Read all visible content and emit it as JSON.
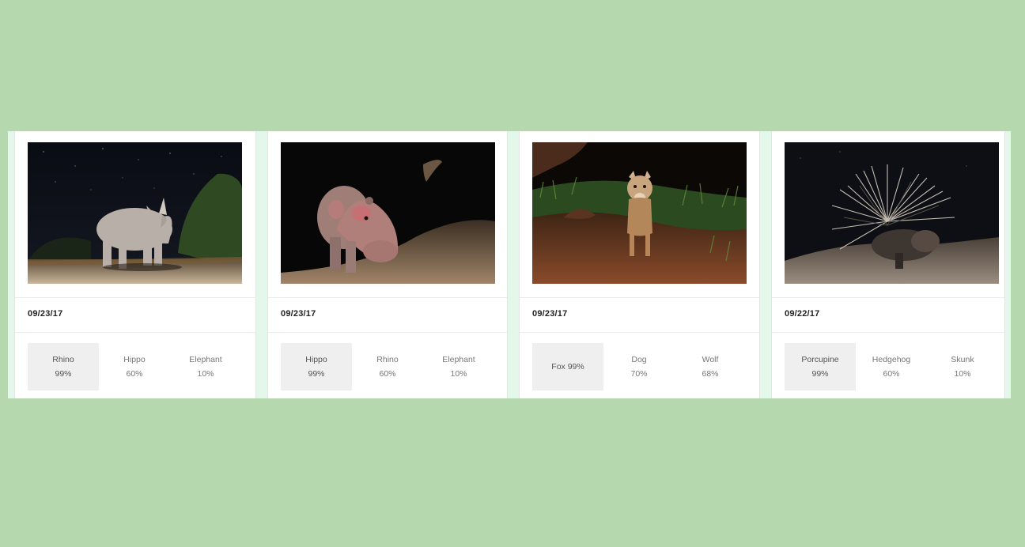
{
  "cards": [
    {
      "date": "09/23/17",
      "photo": "rhino-night-photo",
      "predictions": [
        {
          "name": "Rhino",
          "pct": "99%"
        },
        {
          "name": "Hippo",
          "pct": "60%"
        },
        {
          "name": "Elephant",
          "pct": "10%"
        }
      ]
    },
    {
      "date": "09/23/17",
      "photo": "hippo-night-photo",
      "predictions": [
        {
          "name": "Hippo",
          "pct": "99%"
        },
        {
          "name": "Rhino",
          "pct": "60%"
        },
        {
          "name": "Elephant",
          "pct": "10%"
        }
      ]
    },
    {
      "date": "09/23/17",
      "photo": "jackal-night-photo",
      "predictions": [
        {
          "name": "Fox 99%",
          "pct": ""
        },
        {
          "name": "Dog",
          "pct": "70%"
        },
        {
          "name": "Wolf",
          "pct": "68%"
        }
      ]
    },
    {
      "date": "09/22/17",
      "photo": "porcupine-night-photo",
      "predictions": [
        {
          "name": "Porcupine",
          "pct": "99%"
        },
        {
          "name": "Hedgehog",
          "pct": "60%"
        },
        {
          "name": "Skunk",
          "pct": "10%"
        }
      ]
    }
  ],
  "colors": {
    "background": "#b5d8af",
    "strip": "#e3f7ea",
    "card": "#ffffff",
    "top_prediction_bg": "#efefef"
  }
}
